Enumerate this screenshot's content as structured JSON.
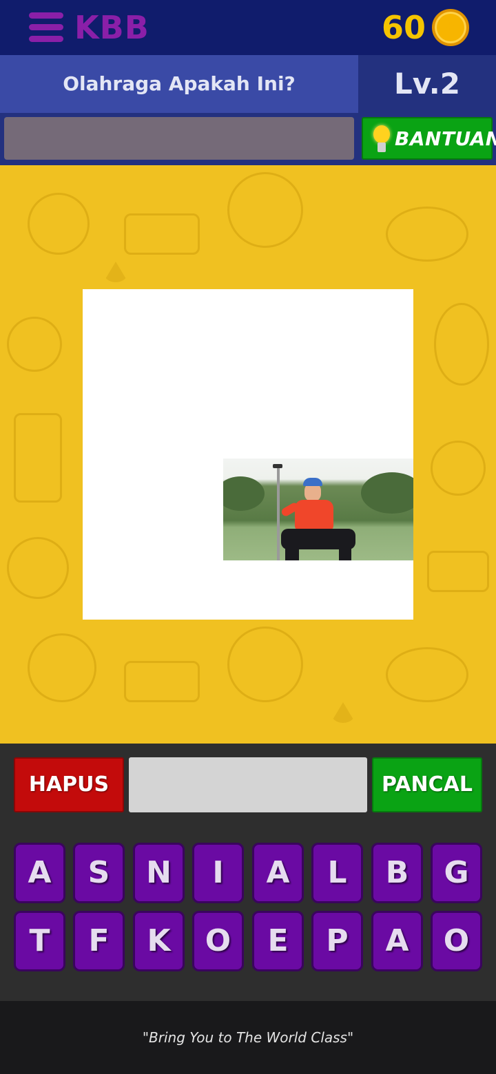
{
  "header": {
    "logo": "KBB",
    "coins": "60",
    "icons": {
      "menu": "hamburger-menu-icon",
      "coin": "dollar-coin-icon"
    }
  },
  "question": {
    "text": "Olahraga Apakah Ini?",
    "level": "Lv.2"
  },
  "answer": {
    "current": ""
  },
  "help": {
    "label": "BANTUAN",
    "icon": "lightbulb-icon"
  },
  "controls": {
    "delete_label": "HAPUS",
    "typed": "",
    "skip_label": "PANCAL"
  },
  "keyboard": {
    "row1": [
      "A",
      "S",
      "N",
      "I",
      "A",
      "L",
      "B",
      "G"
    ],
    "row2": [
      "T",
      "F",
      "K",
      "O",
      "E",
      "P",
      "A",
      "O"
    ]
  },
  "footer": {
    "tagline": "\"Bring You to The World Class\""
  },
  "colors": {
    "header_bg": "#101c6c",
    "question_bg": "#3a4aa6",
    "accent_purple": "#8a1fa8",
    "coin_gold": "#f5c400",
    "play_bg": "#f0c121",
    "delete_red": "#c30b0b",
    "skip_green": "#0aa314",
    "key_purple": "#6a0aa3"
  }
}
